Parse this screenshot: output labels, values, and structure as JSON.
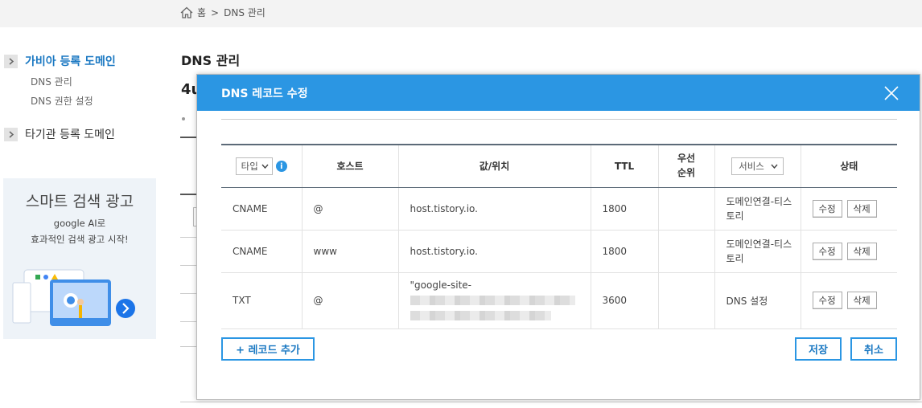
{
  "breadcrumb": {
    "home": "홈",
    "separator": ">",
    "current": "DNS 관리"
  },
  "sidebar": {
    "group1": "가비아 등록 도메인",
    "items": [
      "DNS 관리",
      "DNS 권한 설정"
    ],
    "group2": "타기관 등록 도메인"
  },
  "ad": {
    "title": "스마트 검색 광고",
    "line1": "google AI로",
    "line2": "효과적인 검색 광고 시작!"
  },
  "page": {
    "title": "DNS 관리",
    "domain_partial": "4u"
  },
  "modal": {
    "title": "DNS 레코드 수정",
    "headers": {
      "type": "타입",
      "host": "호스트",
      "value": "값/위치",
      "ttl": "TTL",
      "priority_line1": "우선",
      "priority_line2": "순위",
      "service": "서비스",
      "status": "상태"
    },
    "rows": [
      {
        "type": "CNAME",
        "host": "@",
        "value": "host.tistory.io.",
        "ttl": "1800",
        "priority": "",
        "service": "도메인연결-티스토리"
      },
      {
        "type": "CNAME",
        "host": "www",
        "value": "host.tistory.io.",
        "ttl": "1800",
        "priority": "",
        "service": "도메인연결-티스토리"
      },
      {
        "type": "TXT",
        "host": "@",
        "value": "\"google-site-",
        "ttl": "3600",
        "priority": "",
        "service": "DNS 설정"
      }
    ],
    "edit_label": "수정",
    "delete_label": "삭제",
    "add_record": "+ 레코드 추가",
    "save": "저장",
    "cancel": "취소"
  },
  "colors": {
    "accent": "#2b96e3",
    "link": "#1a78c2"
  }
}
